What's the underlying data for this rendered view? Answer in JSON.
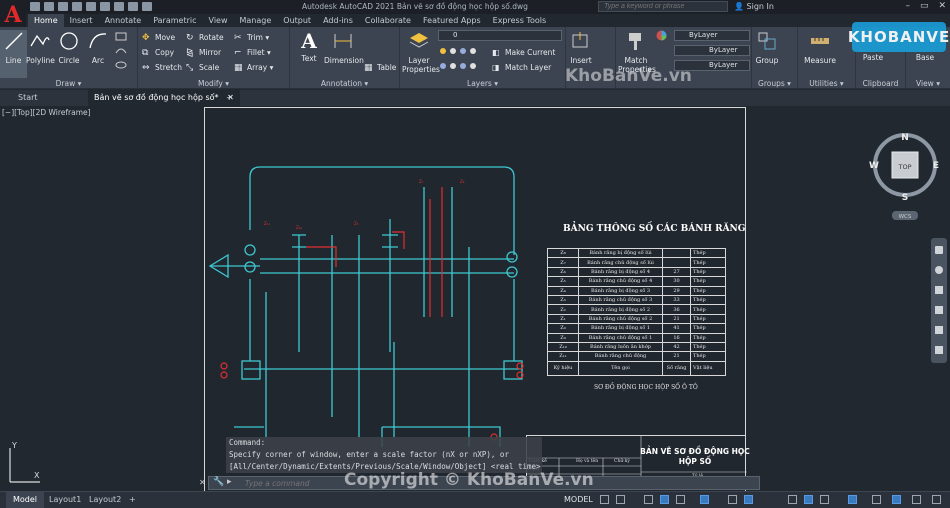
{
  "window": {
    "app_letter": "A",
    "title": "Autodesk AutoCAD 2021    Bản vẽ sơ đồ động học hộp số.dwg",
    "search_placeholder": "Type a keyword or phrase",
    "sign_in": "Sign In",
    "controls": [
      "–",
      "▭",
      "✕"
    ]
  },
  "ribbon_tabs": [
    "Home",
    "Insert",
    "Annotate",
    "Parametric",
    "View",
    "Manage",
    "Output",
    "Add-ins",
    "Collaborate",
    "Featured Apps",
    "Express Tools"
  ],
  "ribbon": {
    "draw": {
      "label": "Draw ▾",
      "line": "Line",
      "polyline": "Polyline",
      "circle": "Circle",
      "arc": "Arc"
    },
    "modify": {
      "label": "Modify ▾",
      "move": "Move",
      "rotate": "Rotate",
      "trim": "Trim ▾",
      "copy": "Copy",
      "mirror": "Mirror",
      "fillet": "Fillet ▾",
      "stretch": "Stretch",
      "scale": "Scale",
      "array": "Array ▾"
    },
    "annotation": {
      "label": "Annotation ▾",
      "text": "Text",
      "dimension": "Dimension",
      "table": "Table"
    },
    "layers": {
      "label": "Layers ▾",
      "layer_properties": "Layer Properties",
      "current_layer": "0",
      "make_current": "Make Current",
      "match_layer": "Match Layer"
    },
    "block": {
      "insert": "Insert"
    },
    "properties": {
      "match_properties": "Match Properties",
      "color": "ByLayer",
      "linetype": "ByLayer",
      "lineweight": "ByLayer"
    },
    "groups": {
      "label": "Groups ▾",
      "group": "Group"
    },
    "utilities": {
      "label": "Utilities ▾",
      "measure": "Measure"
    },
    "clipboard": {
      "label": "Clipboard",
      "paste": "Paste"
    },
    "view": {
      "label": "View ▾",
      "base": "Base"
    }
  },
  "file_tabs": {
    "start": "Start",
    "current": "Bản vẽ sơ đồ động học hộp số*",
    "close": "✕",
    "add": "+"
  },
  "viewport_label": "[−][Top][2D Wireframe]",
  "viewcube": {
    "top": "TOP",
    "n": "N",
    "s": "S",
    "e": "E",
    "w": "W",
    "wcs": "WCS"
  },
  "drawing": {
    "table_title": "BẢNG THÔNG SỐ CÁC BÁNH RĂNG",
    "table_rows": [
      [
        "Z₈",
        "Bánh răng bị động số lùi",
        "",
        "Thép"
      ],
      [
        "Z₇",
        "Bánh răng chủ động số lùi",
        "",
        "Thép"
      ],
      [
        "Z₆",
        "Bánh răng bị động số 4",
        "27",
        "Thép"
      ],
      [
        "Z₅",
        "Bánh răng chủ động số 4",
        "30",
        "Thép"
      ],
      [
        "Z₄",
        "Bánh răng bị động số 3",
        "29",
        "Thép"
      ],
      [
        "Z₃",
        "Bánh răng chủ động số 3",
        "33",
        "Thép"
      ],
      [
        "Z₂",
        "Bánh răng bị động số 2",
        "36",
        "Thép"
      ],
      [
        "Z₁",
        "Bánh răng chủ động số 2",
        "21",
        "Thép"
      ],
      [
        "Z₀",
        "Bánh răng bị động số 1",
        "41",
        "Thép"
      ],
      [
        "Z₉",
        "Bánh răng chủ động số 1",
        "16",
        "Thép"
      ],
      [
        "Z₁₀",
        "Bánh răng luôn ăn khớp",
        "42",
        "Thép"
      ],
      [
        "Z₁₁",
        "Bánh răng chủ động",
        "21",
        "Thép"
      ]
    ],
    "table_header": [
      "Ký hiệu",
      "Tên gọi",
      "Số răng",
      "Vật liệu"
    ],
    "caption": "SƠ ĐỒ ĐỘNG HỌC HỘP SỐ Ô TÔ",
    "title_block_name": "BẢN VẼ SƠ ĐỒ ĐỘNG HỌC HỘP SỐ",
    "title_block_cells": [
      "Thiết kế",
      "Họ và tên",
      "Chữ ký",
      "Ngày",
      "Tỷ lệ"
    ]
  },
  "command_line": {
    "history": [
      "Command:",
      "Specify corner of window, enter a scale factor (nX or nXP), or",
      "[All/Center/Dynamic/Extents/Previous/Scale/Window/Object] <real time>:"
    ],
    "placeholder": "Type a command"
  },
  "status_bar": {
    "tabs": [
      "Model",
      "Layout1",
      "Layout2"
    ],
    "add": "+",
    "mode": "MODEL"
  },
  "watermarks": {
    "logo": "KHOBANVE",
    "top": "KhoBanVe.vn",
    "bottom": "Copyright © KhoBanVe.vn"
  },
  "colors": {
    "accent": "#3b4450",
    "drawing_cyan": "#3ec8d0",
    "drawing_red": "#e03030",
    "app_red": "#e02a2a"
  }
}
